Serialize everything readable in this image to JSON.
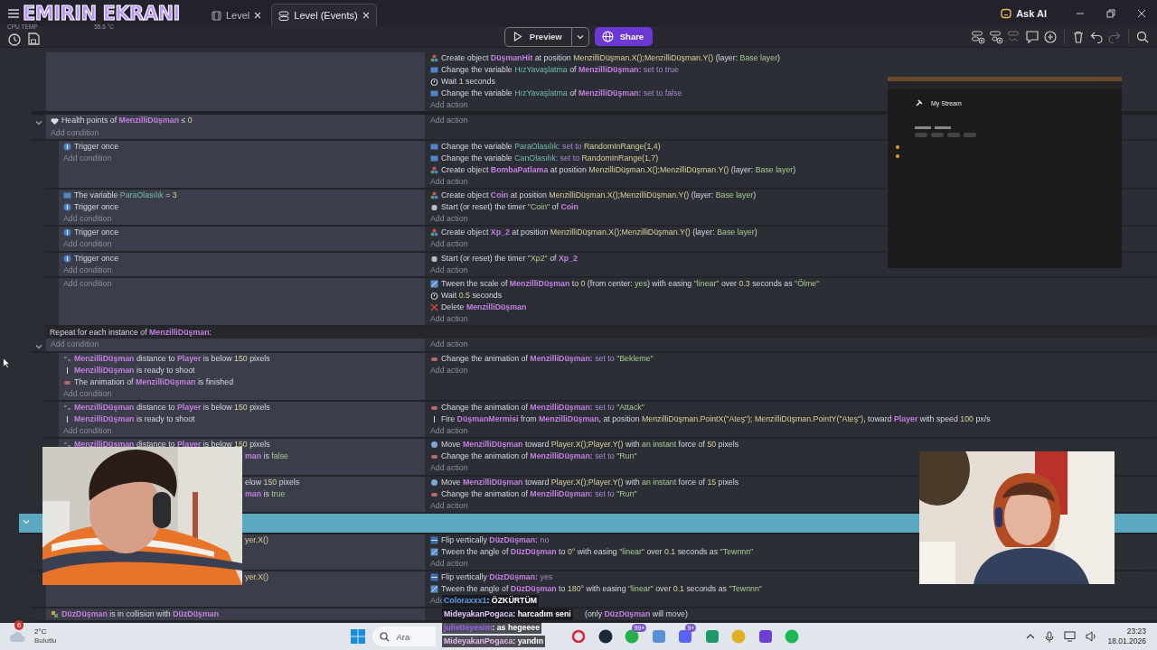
{
  "overlay": {
    "title": "EMIRIN EKRANI",
    "cpu_label": "CPU TEMP",
    "cpu_value": "55.6 °C"
  },
  "tabs": [
    {
      "label": "Level",
      "selected": false,
      "kind": "scene"
    },
    {
      "label": "Level (Events)",
      "selected": true,
      "kind": "events"
    }
  ],
  "ask_ai": "Ask AI",
  "toolbar": {
    "preview": "Preview",
    "share": "Share"
  },
  "events": [
    {
      "children": [
        {
          "actions": [
            {
              "kind": "create",
              "segs": [
                {
                  "text": "Create object ",
                  "kind": "plain"
                },
                {
                  "text": "DüşmanHit",
                  "kind": "object"
                },
                {
                  "text": " at position ",
                  "kind": "plain"
                },
                {
                  "text": "MenzilliDüşman.X();MenzilliDüşman.Y()",
                  "kind": "value"
                },
                {
                  "text": " (layer: ",
                  "kind": "plain"
                },
                {
                  "text": "Base layer",
                  "kind": "string"
                },
                {
                  "text": ")",
                  "kind": "plain"
                }
              ]
            },
            {
              "kind": "variable",
              "segs": [
                {
                  "text": "Change the variable ",
                  "kind": "plain"
                },
                {
                  "text": "HızYavaşlatma",
                  "kind": "variable"
                },
                {
                  "text": " of ",
                  "kind": "plain"
                },
                {
                  "text": "MenzilliDüşman:",
                  "kind": "object"
                },
                {
                  "text": " set to true",
                  "kind": "keyword"
                }
              ]
            },
            {
              "kind": "wait",
              "segs": [
                {
                  "text": "Wait ",
                  "kind": "plain"
                },
                {
                  "text": "1",
                  "kind": "value"
                },
                {
                  "text": " seconds",
                  "kind": "plain"
                }
              ]
            },
            {
              "kind": "variable",
              "segs": [
                {
                  "text": "Change the variable ",
                  "kind": "plain"
                },
                {
                  "text": "HızYavaşlatma",
                  "kind": "variable"
                },
                {
                  "text": " of ",
                  "kind": "plain"
                },
                {
                  "text": "MenzilliDüşman:",
                  "kind": "object"
                },
                {
                  "text": " set to false",
                  "kind": "keyword"
                }
              ]
            }
          ],
          "add_action": "Add action"
        },
        {
          "expanded": true,
          "conditions": [
            {
              "kind": "health",
              "segs": [
                {
                  "text": "Health points of ",
                  "kind": "plain"
                },
                {
                  "text": "MenzilliDüşman",
                  "kind": "object"
                },
                {
                  "text": " ≤ ",
                  "kind": "plain"
                },
                {
                  "text": "0",
                  "kind": "value"
                }
              ]
            }
          ],
          "add_condition": "Add condition",
          "add_action": "Add action",
          "children": [
            {
              "conditions": [
                {
                  "kind": "trigger",
                  "segs": [
                    {
                      "text": "Trigger once",
                      "kind": "plain"
                    }
                  ]
                }
              ],
              "add_condition": "Add condition",
              "actions": [
                {
                  "kind": "variable",
                  "segs": [
                    {
                      "text": "Change the variable ",
                      "kind": "plain"
                    },
                    {
                      "text": "ParaOlasılık",
                      "kind": "variable"
                    },
                    {
                      "text": ": set to ",
                      "kind": "keyword"
                    },
                    {
                      "text": "RandomInRange(1,4)",
                      "kind": "value"
                    }
                  ]
                },
                {
                  "kind": "variable",
                  "segs": [
                    {
                      "text": "Change the variable ",
                      "kind": "plain"
                    },
                    {
                      "text": "CanOlasılık",
                      "kind": "variable"
                    },
                    {
                      "text": ": set to ",
                      "kind": "keyword"
                    },
                    {
                      "text": "RandomInRange(1,7)",
                      "kind": "value"
                    }
                  ]
                },
                {
                  "kind": "create",
                  "segs": [
                    {
                      "text": "Create object ",
                      "kind": "plain"
                    },
                    {
                      "text": "BombaPatlama",
                      "kind": "object"
                    },
                    {
                      "text": " at position ",
                      "kind": "plain"
                    },
                    {
                      "text": "MenzilliDüşman.X();MenzilliDüşman.Y()",
                      "kind": "value"
                    },
                    {
                      "text": " (layer: ",
                      "kind": "plain"
                    },
                    {
                      "text": "Base layer",
                      "kind": "string"
                    },
                    {
                      "text": ")",
                      "kind": "plain"
                    }
                  ]
                }
              ],
              "add_action": "Add action"
            },
            {
              "conditions": [
                {
                  "kind": "variable",
                  "segs": [
                    {
                      "text": "The variable ",
                      "kind": "plain"
                    },
                    {
                      "text": "ParaOlasılık",
                      "kind": "variable"
                    },
                    {
                      "text": " = ",
                      "kind": "plain"
                    },
                    {
                      "text": "3",
                      "kind": "value"
                    }
                  ]
                },
                {
                  "kind": "trigger",
                  "segs": [
                    {
                      "text": "Trigger once",
                      "kind": "plain"
                    }
                  ]
                }
              ],
              "add_condition": "Add condition",
              "actions": [
                {
                  "kind": "create",
                  "segs": [
                    {
                      "text": "Create object ",
                      "kind": "plain"
                    },
                    {
                      "text": "Coin",
                      "kind": "object"
                    },
                    {
                      "text": " at position ",
                      "kind": "plain"
                    },
                    {
                      "text": "MenzilliDüşman.X();MenzilliDüşman.Y()",
                      "kind": "value"
                    },
                    {
                      "text": " (layer: ",
                      "kind": "plain"
                    },
                    {
                      "text": "Base layer",
                      "kind": "string"
                    },
                    {
                      "text": ")",
                      "kind": "plain"
                    }
                  ]
                },
                {
                  "kind": "timer",
                  "segs": [
                    {
                      "text": "Start (or reset) the timer ",
                      "kind": "plain"
                    },
                    {
                      "text": "\"Coin\"",
                      "kind": "string"
                    },
                    {
                      "text": " of ",
                      "kind": "plain"
                    },
                    {
                      "text": "Coin",
                      "kind": "object"
                    }
                  ]
                }
              ],
              "add_action": "Add action"
            },
            {
              "conditions": [
                {
                  "kind": "trigger",
                  "segs": [
                    {
                      "text": "Trigger once",
                      "kind": "plain"
                    }
                  ]
                }
              ],
              "add_condition": "Add condition",
              "actions": [
                {
                  "kind": "create",
                  "segs": [
                    {
                      "text": "Create object ",
                      "kind": "plain"
                    },
                    {
                      "text": "Xp_2",
                      "kind": "object"
                    },
                    {
                      "text": " at position ",
                      "kind": "plain"
                    },
                    {
                      "text": "MenzilliDüşman.X();MenzilliDüşman.Y()",
                      "kind": "value"
                    },
                    {
                      "text": " (layer: ",
                      "kind": "plain"
                    },
                    {
                      "text": "Base layer",
                      "kind": "string"
                    },
                    {
                      "text": ")",
                      "kind": "plain"
                    }
                  ]
                }
              ],
              "add_action": "Add action"
            },
            {
              "conditions": [
                {
                  "kind": "trigger",
                  "segs": [
                    {
                      "text": "Trigger once",
                      "kind": "plain"
                    }
                  ]
                }
              ],
              "add_condition": "Add condition",
              "actions": [
                {
                  "kind": "timer",
                  "segs": [
                    {
                      "text": "Start (or reset) the timer ",
                      "kind": "plain"
                    },
                    {
                      "text": "\"Xp2\"",
                      "kind": "string"
                    },
                    {
                      "text": " of ",
                      "kind": "plain"
                    },
                    {
                      "text": "Xp_2",
                      "kind": "object"
                    }
                  ]
                }
              ],
              "add_action": "Add action"
            },
            {
              "add_condition": "Add condition",
              "actions": [
                {
                  "kind": "tween",
                  "segs": [
                    {
                      "text": "Tween the scale of ",
                      "kind": "plain"
                    },
                    {
                      "text": "MenzilliDüşman",
                      "kind": "object"
                    },
                    {
                      "text": " to ",
                      "kind": "plain"
                    },
                    {
                      "text": "0",
                      "kind": "value"
                    },
                    {
                      "text": " (from center: ",
                      "kind": "plain"
                    },
                    {
                      "text": "yes",
                      "kind": "string"
                    },
                    {
                      "text": ") with easing ",
                      "kind": "plain"
                    },
                    {
                      "text": "\"linear\"",
                      "kind": "string"
                    },
                    {
                      "text": " over ",
                      "kind": "plain"
                    },
                    {
                      "text": "0.3",
                      "kind": "value"
                    },
                    {
                      "text": " seconds as ",
                      "kind": "plain"
                    },
                    {
                      "text": "\"Ölme\"",
                      "kind": "string"
                    }
                  ]
                },
                {
                  "kind": "wait",
                  "segs": [
                    {
                      "text": "Wait ",
                      "kind": "plain"
                    },
                    {
                      "text": "0.5",
                      "kind": "value"
                    },
                    {
                      "text": " seconds",
                      "kind": "plain"
                    }
                  ]
                },
                {
                  "kind": "delete",
                  "segs": [
                    {
                      "text": "Delete ",
                      "kind": "plain"
                    },
                    {
                      "text": "MenzilliDüşman",
                      "kind": "object"
                    }
                  ]
                }
              ],
              "add_action": "Add action"
            }
          ]
        },
        {
          "kind": "repeat",
          "expanded": true,
          "header": [
            {
              "text": "Repeat for each instance of ",
              "kind": "plain"
            },
            {
              "text": "MenzilliDüşman",
              "kind": "object"
            },
            {
              "text": ":",
              "kind": "plain"
            }
          ],
          "add_condition": "Add condition",
          "add_action": "Add action",
          "children": [
            {
              "conditions": [
                {
                  "kind": "distance",
                  "segs": [
                    {
                      "text": "MenzilliDüşman",
                      "kind": "object"
                    },
                    {
                      "text": " distance to ",
                      "kind": "plain"
                    },
                    {
                      "text": "Player",
                      "kind": "object"
                    },
                    {
                      "text": " is below ",
                      "kind": "plain"
                    },
                    {
                      "text": "150",
                      "kind": "value"
                    },
                    {
                      "text": " pixels",
                      "kind": "plain"
                    }
                  ]
                },
                {
                  "kind": "shoot",
                  "segs": [
                    {
                      "text": "MenzilliDüşman",
                      "kind": "object"
                    },
                    {
                      "text": " is ready to shoot",
                      "kind": "plain"
                    }
                  ]
                },
                {
                  "kind": "animation",
                  "segs": [
                    {
                      "text": "The animation of ",
                      "kind": "plain"
                    },
                    {
                      "text": "MenzilliDüşman",
                      "kind": "object"
                    },
                    {
                      "text": " is finished",
                      "kind": "plain"
                    }
                  ]
                }
              ],
              "add_condition": "Add condition",
              "actions": [
                {
                  "kind": "animation",
                  "segs": [
                    {
                      "text": "Change the animation of ",
                      "kind": "plain"
                    },
                    {
                      "text": "MenzilliDüşman:",
                      "kind": "object"
                    },
                    {
                      "text": " set to ",
                      "kind": "keyword"
                    },
                    {
                      "text": "\"Bekleme\"",
                      "kind": "string"
                    }
                  ]
                }
              ],
              "add_action": "Add action"
            },
            {
              "conditions": [
                {
                  "kind": "distance",
                  "segs": [
                    {
                      "text": "MenzilliDüşman",
                      "kind": "object"
                    },
                    {
                      "text": " distance to ",
                      "kind": "plain"
                    },
                    {
                      "text": "Player",
                      "kind": "object"
                    },
                    {
                      "text": " is below ",
                      "kind": "plain"
                    },
                    {
                      "text": "150",
                      "kind": "value"
                    },
                    {
                      "text": " pixels",
                      "kind": "plain"
                    }
                  ]
                },
                {
                  "kind": "shoot",
                  "segs": [
                    {
                      "text": "MenzilliDüşman",
                      "kind": "object"
                    },
                    {
                      "text": " is ready to shoot",
                      "kind": "plain"
                    }
                  ]
                }
              ],
              "add_condition": "Add condition",
              "actions": [
                {
                  "kind": "animation",
                  "segs": [
                    {
                      "text": "Change the animation of ",
                      "kind": "plain"
                    },
                    {
                      "text": "MenzilliDüşman:",
                      "kind": "object"
                    },
                    {
                      "text": " set to ",
                      "kind": "keyword"
                    },
                    {
                      "text": "\"Attack\"",
                      "kind": "string"
                    }
                  ]
                },
                {
                  "kind": "fire",
                  "segs": [
                    {
                      "text": "Fire ",
                      "kind": "plain"
                    },
                    {
                      "text": "DüşmanMermisi",
                      "kind": "object"
                    },
                    {
                      "text": " from ",
                      "kind": "plain"
                    },
                    {
                      "text": "MenzilliDüşman",
                      "kind": "object"
                    },
                    {
                      "text": ", at position ",
                      "kind": "plain"
                    },
                    {
                      "text": "MenzilliDüşman.PointX(\"Ateş\"); MenzilliDüşman.PointY(\"Ateş\")",
                      "kind": "value"
                    },
                    {
                      "text": ", toward ",
                      "kind": "plain"
                    },
                    {
                      "text": "Player",
                      "kind": "object"
                    },
                    {
                      "text": " with speed ",
                      "kind": "plain"
                    },
                    {
                      "text": "100",
                      "kind": "value"
                    },
                    {
                      "text": " px/s",
                      "kind": "plain"
                    }
                  ]
                }
              ],
              "add_action": "Add action"
            },
            {
              "conditions": [
                {
                  "kind": "distance",
                  "segs": [
                    {
                      "text": "MenzilliDüşman",
                      "kind": "object"
                    },
                    {
                      "text": " distance to ",
                      "kind": "plain"
                    },
                    {
                      "text": "Player",
                      "kind": "object"
                    },
                    {
                      "text": " is below ",
                      "kind": "plain"
                    },
                    {
                      "text": "150",
                      "kind": "value"
                    },
                    {
                      "text": " pixels",
                      "kind": "plain"
                    }
                  ]
                },
                {
                  "kind": "clipped",
                  "segs": [
                    {
                      "text": "man",
                      "kind": "object"
                    },
                    {
                      "text": " is ",
                      "kind": "plain"
                    },
                    {
                      "text": "false",
                      "kind": "string"
                    }
                  ]
                }
              ],
              "actions": [
                {
                  "kind": "move",
                  "segs": [
                    {
                      "text": "Move ",
                      "kind": "plain"
                    },
                    {
                      "text": "MenzilliDüşman",
                      "kind": "object"
                    },
                    {
                      "text": " toward ",
                      "kind": "plain"
                    },
                    {
                      "text": "Player.X();Player.Y()",
                      "kind": "value"
                    },
                    {
                      "text": " with ",
                      "kind": "plain"
                    },
                    {
                      "text": "an instant",
                      "kind": "string"
                    },
                    {
                      "text": " force of ",
                      "kind": "plain"
                    },
                    {
                      "text": "50",
                      "kind": "value"
                    },
                    {
                      "text": " pixels",
                      "kind": "plain"
                    }
                  ]
                },
                {
                  "kind": "animation",
                  "segs": [
                    {
                      "text": "Change the animation of ",
                      "kind": "plain"
                    },
                    {
                      "text": "MenzilliDüşman:",
                      "kind": "object"
                    },
                    {
                      "text": " set to ",
                      "kind": "keyword"
                    },
                    {
                      "text": "\"Run\"",
                      "kind": "string"
                    }
                  ]
                }
              ],
              "add_action": "Add action"
            },
            {
              "conditions": [
                {
                  "kind": "clipped",
                  "segs": [
                    {
                      "text": "elow ",
                      "kind": "plain"
                    },
                    {
                      "text": "150",
                      "kind": "value"
                    },
                    {
                      "text": " pixels",
                      "kind": "plain"
                    }
                  ]
                },
                {
                  "kind": "clipped",
                  "segs": [
                    {
                      "text": "man",
                      "kind": "object"
                    },
                    {
                      "text": " is ",
                      "kind": "plain"
                    },
                    {
                      "text": "true",
                      "kind": "string"
                    }
                  ]
                }
              ],
              "actions": [
                {
                  "kind": "move",
                  "segs": [
                    {
                      "text": "Move ",
                      "kind": "plain"
                    },
                    {
                      "text": "MenzilliDüşman",
                      "kind": "object"
                    },
                    {
                      "text": " toward ",
                      "kind": "plain"
                    },
                    {
                      "text": "Player.X();Player.Y()",
                      "kind": "value"
                    },
                    {
                      "text": " with ",
                      "kind": "plain"
                    },
                    {
                      "text": "an instant",
                      "kind": "string"
                    },
                    {
                      "text": " force of ",
                      "kind": "plain"
                    },
                    {
                      "text": "15",
                      "kind": "value"
                    },
                    {
                      "text": " pixels",
                      "kind": "plain"
                    }
                  ]
                },
                {
                  "kind": "animation",
                  "segs": [
                    {
                      "text": "Change the animation of ",
                      "kind": "plain"
                    },
                    {
                      "text": "MenzilliDüşman:",
                      "kind": "object"
                    },
                    {
                      "text": " set to ",
                      "kind": "keyword"
                    },
                    {
                      "text": "\"Run\"",
                      "kind": "string"
                    }
                  ]
                }
              ],
              "add_action": "Add action"
            }
          ]
        }
      ]
    },
    {
      "selected": true,
      "expanded": true,
      "children": [
        {
          "conditions": [
            {
              "kind": "clipped",
              "segs": [
                {
                  "text": "yer.X()",
                  "kind": "value"
                }
              ]
            }
          ],
          "actions": [
            {
              "kind": "flip",
              "segs": [
                {
                  "text": "Flip vertically ",
                  "kind": "plain"
                },
                {
                  "text": "DüzDüşman:",
                  "kind": "object"
                },
                {
                  "text": " no",
                  "kind": "keyword"
                }
              ]
            },
            {
              "kind": "tween",
              "segs": [
                {
                  "text": "Tween the angle of ",
                  "kind": "plain"
                },
                {
                  "text": "DüzDüşman",
                  "kind": "object"
                },
                {
                  "text": " to ",
                  "kind": "plain"
                },
                {
                  "text": "0°",
                  "kind": "value"
                },
                {
                  "text": " with easing ",
                  "kind": "plain"
                },
                {
                  "text": "\"linear\"",
                  "kind": "string"
                },
                {
                  "text": " over ",
                  "kind": "plain"
                },
                {
                  "text": "0.1",
                  "kind": "value"
                },
                {
                  "text": " seconds as ",
                  "kind": "plain"
                },
                {
                  "text": "\"Tewnnn\"",
                  "kind": "string"
                }
              ]
            }
          ],
          "add_action": "Add action"
        },
        {
          "conditions": [
            {
              "kind": "clipped",
              "segs": [
                {
                  "text": "yer.X()",
                  "kind": "value"
                }
              ]
            }
          ],
          "actions": [
            {
              "kind": "flip",
              "segs": [
                {
                  "text": "Flip vertically ",
                  "kind": "plain"
                },
                {
                  "text": "DüzDüşman:",
                  "kind": "object"
                },
                {
                  "text": " yes",
                  "kind": "keyword"
                }
              ]
            },
            {
              "kind": "tween",
              "segs": [
                {
                  "text": "Tween the angle of ",
                  "kind": "plain"
                },
                {
                  "text": "DüzDüşman",
                  "kind": "object"
                },
                {
                  "text": " to ",
                  "kind": "plain"
                },
                {
                  "text": "180°",
                  "kind": "value"
                },
                {
                  "text": " with easing ",
                  "kind": "plain"
                },
                {
                  "text": "\"linear\"",
                  "kind": "string"
                },
                {
                  "text": " over ",
                  "kind": "plain"
                },
                {
                  "text": "0.1",
                  "kind": "value"
                },
                {
                  "text": " seconds as ",
                  "kind": "plain"
                },
                {
                  "text": "\"Tewnnn\"",
                  "kind": "string"
                }
              ]
            }
          ],
          "add_action": "Add"
        },
        {
          "conditions": [
            {
              "kind": "collision",
              "segs": [
                {
                  "text": "DüzDüşman",
                  "kind": "object"
                },
                {
                  "text": " is in collision with ",
                  "kind": "plain"
                },
                {
                  "text": "DüzDüşman",
                  "kind": "object"
                }
              ]
            }
          ],
          "actions": [
            {
              "kind": "clipped",
              "segs": [
                {
                  "text": "(only ",
                  "kind": "plain"
                },
                {
                  "text": "DüzDüşman",
                  "kind": "object"
                },
                {
                  "text": " will move)",
                  "kind": "plain"
                }
              ]
            }
          ]
        }
      ]
    }
  ],
  "embedded_window": {
    "title": "My Stream"
  },
  "chat": [
    {
      "user": "Coloraxxx1",
      "message": ": ÖZKÜRTÜM",
      "color": "#5a9fe6"
    },
    {
      "user": "MideyakanPogaca",
      "message": ": harcadım seni",
      "color": "#e2c8fa"
    },
    {
      "user": "julietteyesim",
      "message": ": as hegeeee",
      "color": "#9b5ff0"
    },
    {
      "user": "MideyakanPogaca",
      "message": ": yandın",
      "color": "#e8b8f0"
    }
  ],
  "taskbar": {
    "weather_badge": "6",
    "temperature": "2°C",
    "weather": "Bulutlu",
    "search_placeholder": "Ara",
    "apps": [
      {
        "kind": "ring"
      },
      {
        "kind": "steam"
      },
      {
        "kind": "phone",
        "badge": "99+"
      },
      {
        "kind": "grid"
      },
      {
        "kind": "gamepad",
        "badge": "9+"
      },
      {
        "kind": "square"
      },
      {
        "kind": "chrome"
      },
      {
        "kind": "letter"
      },
      {
        "kind": "music"
      }
    ],
    "time": "23:23",
    "date": "18.01.2026"
  }
}
